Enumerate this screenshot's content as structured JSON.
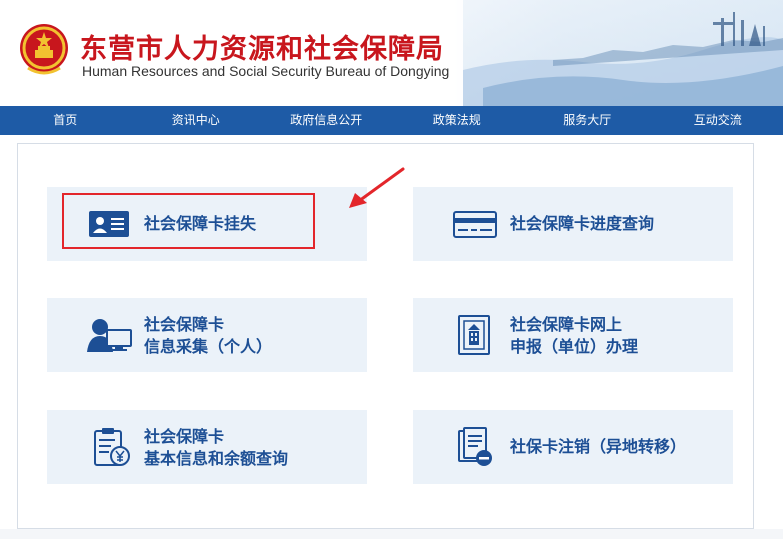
{
  "header": {
    "title_cn": "东营市人力资源和社会保障局",
    "title_en": "Human Resources and Social Security Bureau of Dongying",
    "emblem_icon": "national-emblem-icon"
  },
  "nav": {
    "items": [
      {
        "label": "首页"
      },
      {
        "label": "资讯中心"
      },
      {
        "label": "政府信息公开"
      },
      {
        "label": "政策法规"
      },
      {
        "label": "服务大厅"
      },
      {
        "label": "互动交流"
      }
    ]
  },
  "services": [
    {
      "line1": "社会保障卡挂失",
      "line2": "",
      "icon": "id-card-icon"
    },
    {
      "line1": "社会保障卡进度查询",
      "line2": "",
      "icon": "credit-card-icon"
    },
    {
      "line1": "社会保障卡",
      "line2": "信息采集（个人）",
      "icon": "person-computer-icon"
    },
    {
      "line1": "社会保障卡网上",
      "line2": "申报（单位）办理",
      "icon": "document-building-icon"
    },
    {
      "line1": "社会保障卡",
      "line2": "基本信息和余额查询",
      "icon": "clipboard-yuan-icon"
    },
    {
      "line1": "社保卡注销（异地转移）",
      "line2": "",
      "icon": "document-minus-icon"
    }
  ],
  "colors": {
    "nav_bg": "#1e5ba6",
    "tile_bg": "#ebf2f9",
    "tile_text": "#1d4f95",
    "title_red": "#c8161d",
    "highlight_red": "#e3262b"
  }
}
